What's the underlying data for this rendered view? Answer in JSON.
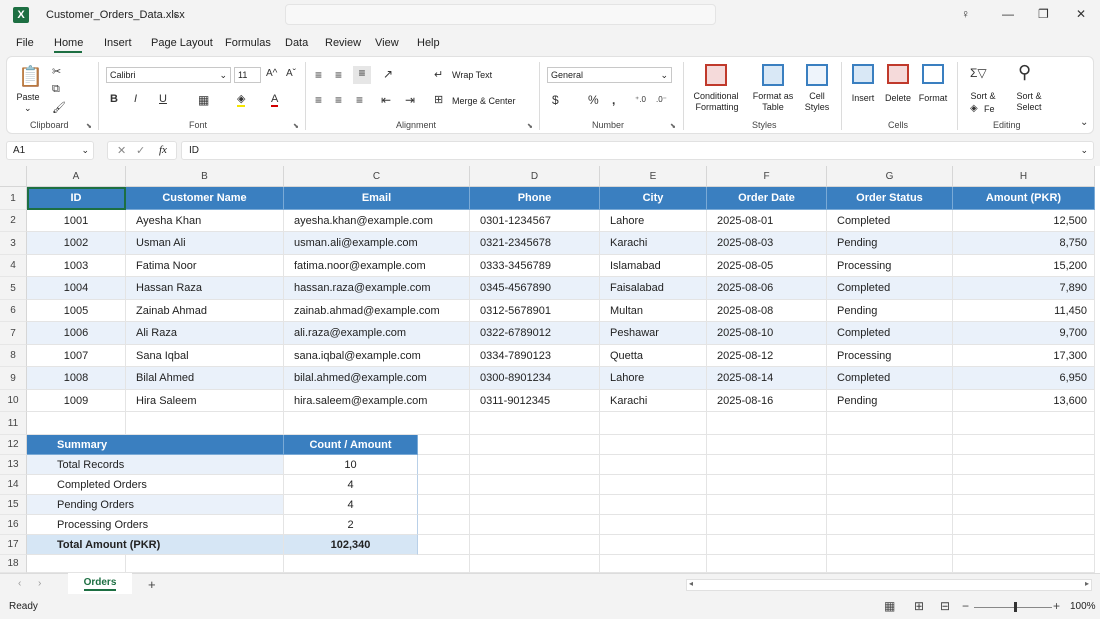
{
  "window": {
    "file_name": "Customer_Orders_Data.xlsx",
    "logo_letter": "X"
  },
  "menu": [
    "File",
    "Home",
    "Insert",
    "Page Layout",
    "Formulas",
    "Data",
    "Review",
    "View",
    "Help"
  ],
  "ribbon": {
    "paste_label": "Paste",
    "clipboard_group": "Clipboard",
    "font_name": "Calibri",
    "font_size": "11",
    "font_group": "Font",
    "wrap_text": "Wrap Text",
    "merge_center": "Merge & Center",
    "alignment_group": "Alignment",
    "number_format": "General",
    "number_group": "Number",
    "conditional_formatting_1": "Conditional",
    "conditional_formatting_2": "Formatting",
    "format_as_table_1": "Format as",
    "format_as_table_2": "Table",
    "cell_styles_1": "Cell",
    "cell_styles_2": "Styles",
    "styles_group": "Styles",
    "insert": "Insert",
    "delete": "Delete",
    "format": "Format",
    "cells_group": "Cells",
    "sort_filter_1": "Sort &",
    "sort_filter_2": "Fe",
    "find_select_1": "Sort &",
    "find_select_2": "Select",
    "editing_group": "Editing"
  },
  "formula_bar": {
    "name_box": "A1",
    "fx": "fx",
    "formula": "ID"
  },
  "columns": [
    "A",
    "B",
    "C",
    "D",
    "E",
    "F",
    "G",
    "H"
  ],
  "rows": [
    "1",
    "2",
    "3",
    "4",
    "5",
    "6",
    "7",
    "8",
    "9",
    "10",
    "11",
    "12",
    "13",
    "14",
    "15",
    "16",
    "17",
    "18"
  ],
  "table": {
    "headers": [
      "ID",
      "Customer Name",
      "Email",
      "Phone",
      "City",
      "Order Date",
      "Order Status",
      "Amount (PKR)"
    ],
    "records": [
      [
        "1001",
        "Ayesha Khan",
        "ayesha.khan@example.com",
        "0301-1234567",
        "Lahore",
        "2025-08-01",
        "Completed",
        "12,500"
      ],
      [
        "1002",
        "Usman Ali",
        "usman.ali@example.com",
        "0321-2345678",
        "Karachi",
        "2025-08-03",
        "Pending",
        "8,750"
      ],
      [
        "1003",
        "Fatima Noor",
        "fatima.noor@example.com",
        "0333-3456789",
        "Islamabad",
        "2025-08-05",
        "Processing",
        "15,200"
      ],
      [
        "1004",
        "Hassan Raza",
        "hassan.raza@example.com",
        "0345-4567890",
        "Faisalabad",
        "2025-08-06",
        "Completed",
        "7,890"
      ],
      [
        "1005",
        "Zainab Ahmad",
        "zainab.ahmad@example.com",
        "0312-5678901",
        "Multan",
        "2025-08-08",
        "Pending",
        "11,450"
      ],
      [
        "1006",
        "Ali Raza",
        "ali.raza@example.com",
        "0322-6789012",
        "Peshawar",
        "2025-08-10",
        "Completed",
        "9,700"
      ],
      [
        "1007",
        "Sana Iqbal",
        "sana.iqbal@example.com",
        "0334-7890123",
        "Quetta",
        "2025-08-12",
        "Processing",
        "17,300"
      ],
      [
        "1008",
        "Bilal Ahmed",
        "bilal.ahmed@example.com",
        "0300-8901234",
        "Lahore",
        "2025-08-14",
        "Completed",
        "6,950"
      ],
      [
        "1009",
        "Hira Saleem",
        "hira.saleem@example.com",
        "0311-9012345",
        "Karachi",
        "2025-08-16",
        "Pending",
        "13,600"
      ]
    ]
  },
  "summary": {
    "header_label": "Summary",
    "header_value": "Count / Amount",
    "rows": [
      [
        "Total Records",
        "10"
      ],
      [
        "Completed Orders",
        "4"
      ],
      [
        "Pending Orders",
        "4"
      ],
      [
        "Processing Orders",
        "2"
      ],
      [
        "Total Amount (PKR)",
        "102,340"
      ]
    ]
  },
  "sheets": {
    "active": "Orders",
    "add": "+"
  },
  "status": {
    "ready": "Ready",
    "zoom": "100%"
  },
  "colors": {
    "header_blue": "#3a7fc0",
    "band_blue": "#eaf1fa",
    "excel_green": "#1d6f42"
  }
}
